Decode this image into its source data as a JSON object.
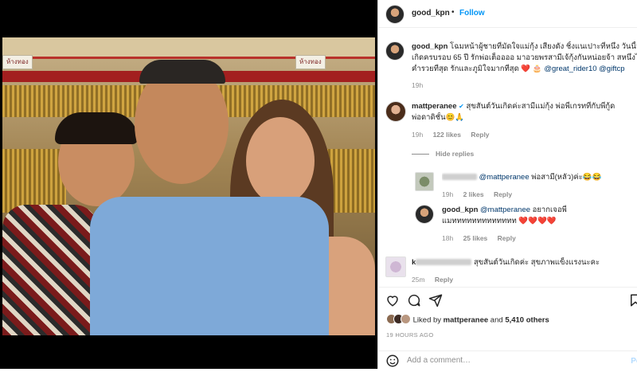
{
  "header": {
    "username": "good_kpn",
    "dot": "•",
    "follow_label": "Follow"
  },
  "caption": {
    "username": "good_kpn",
    "line1": "โฉมหน้าผู้ชายที่มัดใจแม่กุ้ง เสียงดัง ชิ้งแนเปาะที่หนึ่ง วันนี้วัน",
    "line2": "เกิดครบรอบ 65 ปี รักพ่อเต็ออออ มาอวยพรสามีเจ้กุ้งกันหน่อยจ้า สหนึ่งไม่",
    "line3": "ค่ำรวยที่สุด รักและภูมิใจมากที่สุด ❤️ 🎂",
    "mention1": "@great_rider10",
    "mention2": "@giftcp",
    "time": "19h"
  },
  "comments": [
    {
      "username": "matt peranee",
      "username_text": "mattperanee",
      "verified": "✔",
      "line1": "สุขสันต์วันเกิดค่ะสามีแม่กุ้ง พ่อพี่เกรทที่กับพี่กู้ด",
      "line2": "พ่อดาดิชั้น😊🙏",
      "time": "19h",
      "likes": "122 likes",
      "reply": "Reply",
      "hide_replies": "Hide replies"
    }
  ],
  "replies": [
    {
      "mention": "@mattperanee",
      "text": " พ่อสามี(หลัว)ค่ะ😂😂",
      "time": "19h",
      "likes": "2 likes",
      "reply": "Reply"
    },
    {
      "username": "good_kpn",
      "mention": "@mattperanee",
      "text": " อยากเจอพี่",
      "line2": "แมททททททททททททท ❤️❤️❤️❤️",
      "time": "18h",
      "likes": "25 likes",
      "reply": "Reply"
    }
  ],
  "comment3": {
    "username_prefix": "k",
    "text": "สุขสันต์วันเกิดค่ะ สุขภาพแข็งแรงนะคะ",
    "time": "25m",
    "reply": "Reply"
  },
  "likes": {
    "prefix": "Liked by ",
    "user": "mattperanee",
    "and": " and ",
    "others": "5,410 others"
  },
  "timestamp": "19 HOURS AGO",
  "add_comment": {
    "placeholder": "Add a comment…",
    "post_label": "Po"
  },
  "photo": {
    "sign1": "ห้างทอง",
    "sign2": "ห้างทอง"
  },
  "colors": {
    "link": "#0095f6",
    "mention": "#00376b",
    "heart": "#ed4956"
  },
  "icons": [
    "heart-icon",
    "comment-icon",
    "share-icon",
    "bookmark-icon",
    "emoji-icon",
    "verified-icon"
  ]
}
